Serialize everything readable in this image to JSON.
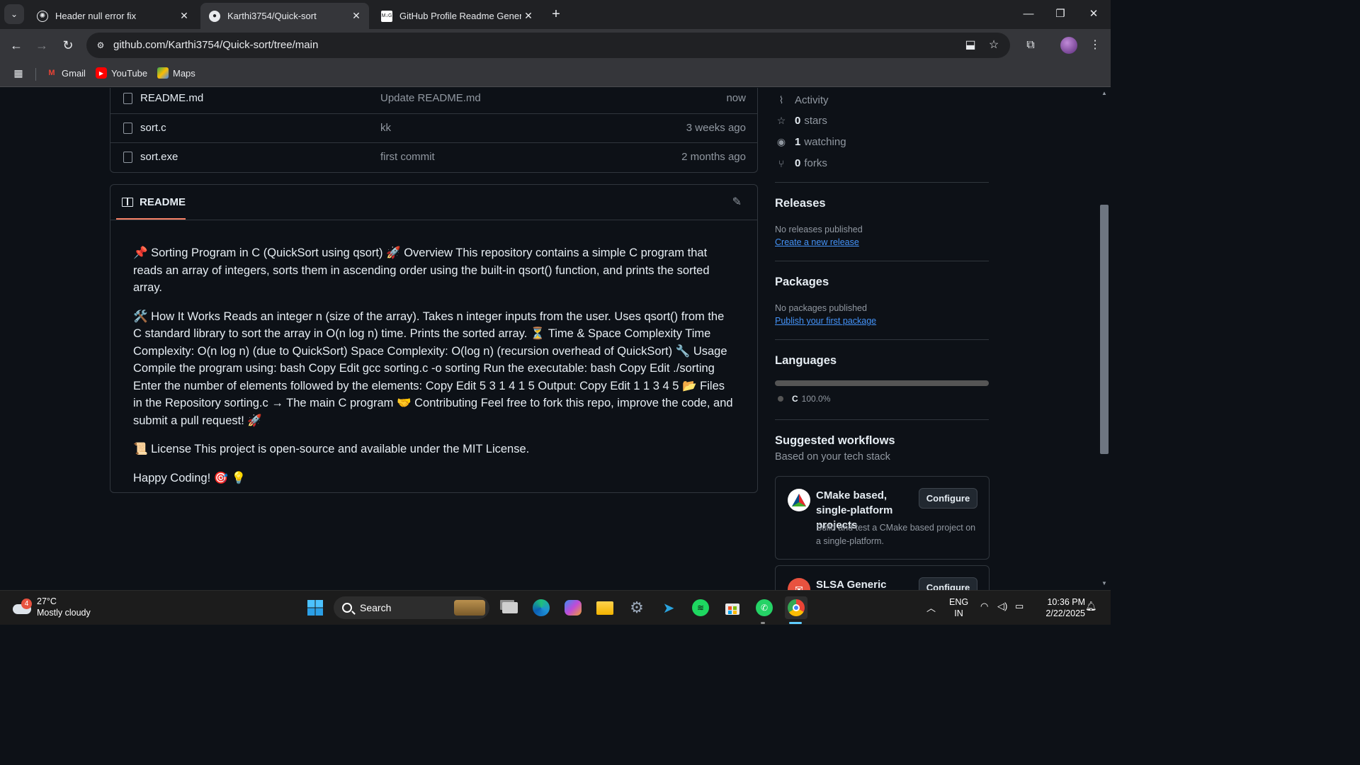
{
  "browser": {
    "tabs": [
      {
        "title": "Header null error fix",
        "favicon": "openai-icon",
        "active": false
      },
      {
        "title": "Karthi3754/Quick-sort",
        "favicon": "github-icon",
        "active": true
      },
      {
        "title": "GitHub Profile Readme Generat",
        "favicon": "readme-generator-icon",
        "active": false
      }
    ],
    "url": "github.com/Karthi3754/Quick-sort/tree/main",
    "bookmarks": [
      {
        "label": "Gmail",
        "icon": "gmail-icon"
      },
      {
        "label": "YouTube",
        "icon": "youtube-icon"
      },
      {
        "label": "Maps",
        "icon": "maps-icon"
      }
    ]
  },
  "files": [
    {
      "name": "README.md",
      "message": "Update README.md",
      "date": "now"
    },
    {
      "name": "sort.c",
      "message": "kk",
      "date": "3 weeks ago"
    },
    {
      "name": "sort.exe",
      "message": "first commit",
      "date": "2 months ago"
    }
  ],
  "readme": {
    "tab_label": "README",
    "paragraphs": [
      "📌 Sorting Program in C (QuickSort using qsort) 🚀 Overview This repository contains a simple C program that reads an array of integers, sorts them in ascending order using the built-in qsort() function, and prints the sorted array.",
      "🛠️ How It Works Reads an integer n (size of the array). Takes n integer inputs from the user. Uses qsort() from the C standard library to sort the array in O(n log n) time. Prints the sorted array. ⏳ Time & Space Complexity Time Complexity: O(n log n) (due to QuickSort) Space Complexity: O(log n) (recursion overhead of QuickSort) 🔧 Usage Compile the program using: bash Copy Edit gcc sorting.c -o sorting Run the executable: bash Copy Edit ./sorting Enter the number of elements followed by the elements: Copy Edit 5 3 1 4 1 5 Output: Copy Edit 1 1 3 4 5 📂 Files in the Repository sorting.c → The main C program 🤝 Contributing Feel free to fork this repo, improve the code, and submit a pull request! 🚀",
      "📜 License This project is open-source and available under the MIT License.",
      "Happy Coding! 🎯 💡"
    ]
  },
  "sidebar": {
    "activity_label": "Activity",
    "stars": {
      "count": "0",
      "label": "stars"
    },
    "watching": {
      "count": "1",
      "label": "watching"
    },
    "forks": {
      "count": "0",
      "label": "forks"
    },
    "releases": {
      "heading": "Releases",
      "empty": "No releases published",
      "link": "Create a new release"
    },
    "packages": {
      "heading": "Packages",
      "empty": "No packages published",
      "link": "Publish your first package"
    },
    "languages": {
      "heading": "Languages",
      "name": "C",
      "percent": "100.0%",
      "share": 1.0,
      "color": "#555555"
    },
    "workflows": {
      "heading": "Suggested workflows",
      "subheading": "Based on your tech stack",
      "items": [
        {
          "title": "CMake based, single-platform projects",
          "description": "Build and test a CMake based project on a single-platform.",
          "button": "Configure"
        },
        {
          "title": "SLSA Generic",
          "description": "",
          "button": "Configure"
        }
      ]
    }
  },
  "taskbar": {
    "weather": {
      "temp": "27°C",
      "condition": "Mostly cloudy",
      "badge": "4"
    },
    "search_label": "Search",
    "lang_top": "ENG",
    "lang_bottom": "IN",
    "time": "10:36 PM",
    "date": "2/22/2025"
  },
  "colors": {
    "accent_link": "#4493f8",
    "tab_underline": "#f78166",
    "page_bg": "#0d1117"
  }
}
